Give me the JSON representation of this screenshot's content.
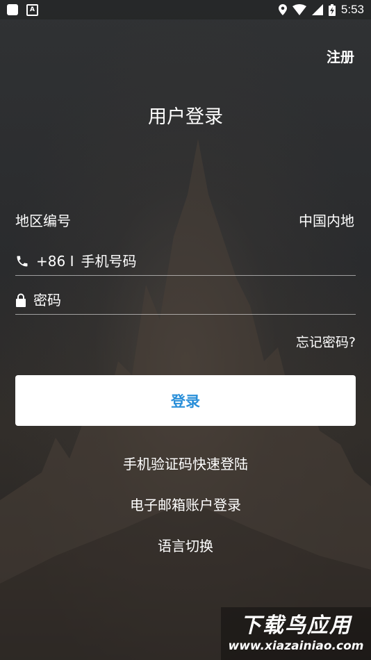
{
  "status_bar": {
    "time": "5:53",
    "left_icons": [
      "app-square-icon",
      "a-icon"
    ],
    "right_icons": [
      "location-icon",
      "wifi-icon",
      "signal-icon",
      "battery-icon"
    ]
  },
  "header": {
    "register_label": "注册",
    "title": "用户登录"
  },
  "region": {
    "label": "地区编号",
    "value": "中国内地"
  },
  "phone": {
    "prefix": "+86 I",
    "placeholder": "手机号码"
  },
  "password": {
    "placeholder": "密码"
  },
  "forgot_label": "忘记密码?",
  "login_label": "登录",
  "links": {
    "sms_login": "手机验证码快速登陆",
    "email_login": "电子邮箱账户登录",
    "language": "语言切换"
  },
  "watermark": {
    "line1": "下载鸟应用",
    "line2": "www.xiazainiao.com"
  },
  "colors": {
    "accent": "#2a8fd9",
    "background": "#2b2c2e",
    "text": "#ffffff"
  }
}
